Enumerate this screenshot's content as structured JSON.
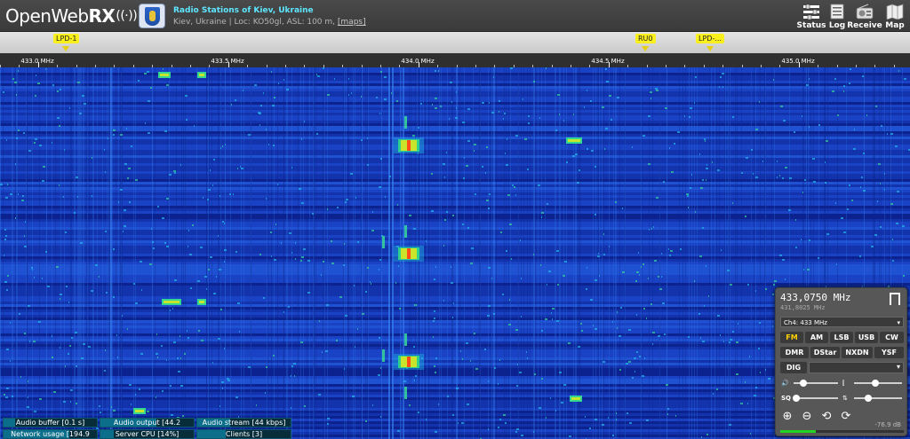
{
  "header": {
    "logo_open": "Open",
    "logo_web": "Web",
    "logo_rx": "RX",
    "receiver_title": "Radio Stations of Kiev, Ukraine",
    "receiver_desc": "Kiev, Ukraine | Loc: KO50gl, ASL: 100 m,",
    "maps_link": "[maps]",
    "buttons": {
      "status": "Status",
      "log": "Log",
      "receive": "Receive",
      "map": "Map"
    }
  },
  "bookmarks": [
    {
      "label": "LPD-1"
    },
    {
      "label": "RU0"
    },
    {
      "label": "LPD-..."
    }
  ],
  "scale": {
    "labels": [
      "433.0 MHz",
      "433.5 MHz",
      "434.0 MHz",
      "434.5 MHz",
      "435.0 MHz"
    ]
  },
  "status": {
    "audio_buffer": "Audio buffer [0.1 s]",
    "audio_output": "Audio output [44.2",
    "audio_stream": "Audio stream [44 kbps]",
    "network_usage": "Network usage [194.9",
    "server_cpu": "Server CPU [14%]",
    "clients": "Clients [3]",
    "server_cpu_level": 0.14
  },
  "receiver": {
    "frequency": "433,0750 MHz",
    "frequency_sub": "431,8025 MHz",
    "preset": "Ch4: 433 MHz",
    "modes_row1": [
      "FM",
      "AM",
      "LSB",
      "USB",
      "CW"
    ],
    "modes_row2": [
      "DMR",
      "DStar",
      "NXDN",
      "YSF"
    ],
    "dig_label": "DIG",
    "active_mode": "FM",
    "smeter_value": "-76.9 dB",
    "smeter_level": 0.29,
    "volume_level": 0.22,
    "nr_level": 0.45,
    "squelch_level": 0.05,
    "gain_level": 0.3
  },
  "colors": {
    "accent": "#ffd200",
    "bookmark": "#f8ef1d",
    "title": "#5ee6ff"
  }
}
